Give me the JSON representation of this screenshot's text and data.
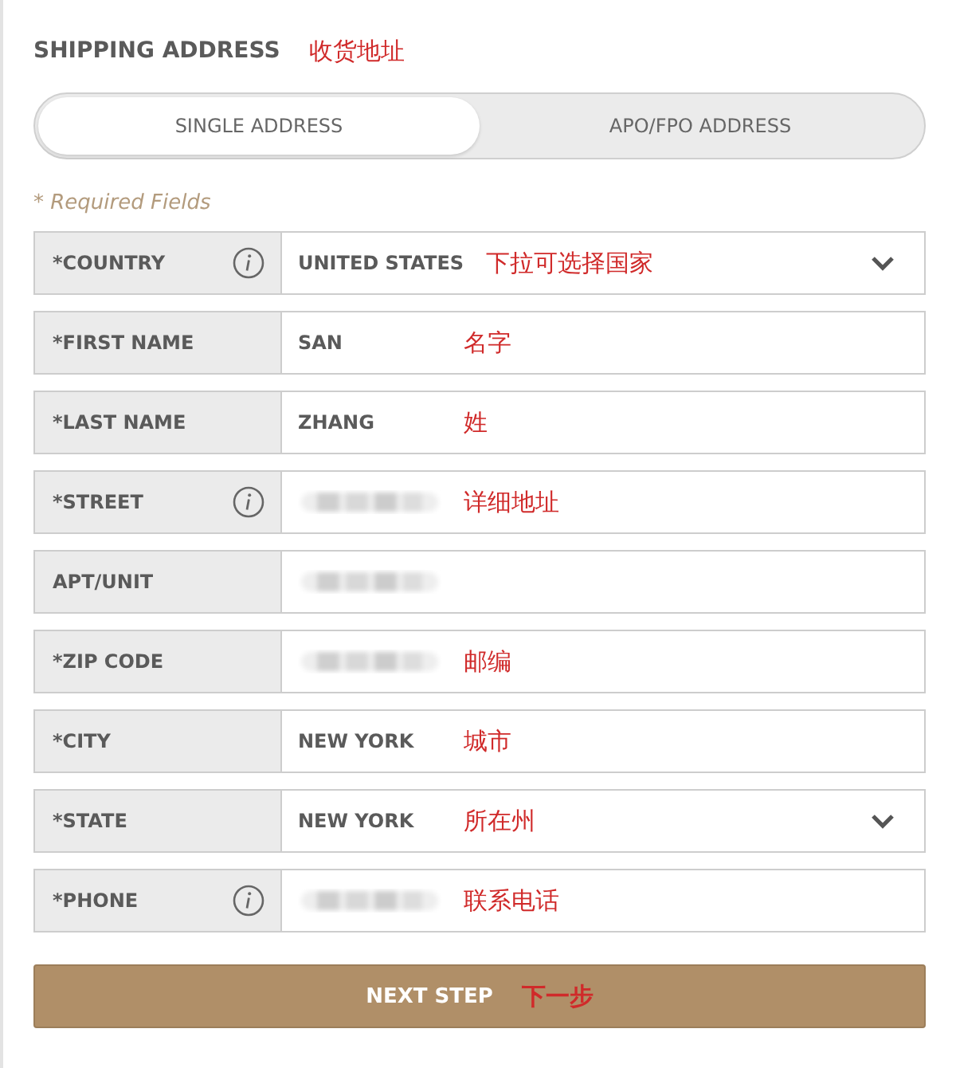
{
  "heading": {
    "title": "SHIPPING ADDRESS",
    "annotation": "收货地址"
  },
  "address_type_tabs": [
    {
      "label": "SINGLE ADDRESS",
      "selected": true
    },
    {
      "label": "APO/FPO ADDRESS",
      "selected": false
    }
  ],
  "required_note": "* Required Fields",
  "fields": [
    {
      "kind": "select",
      "label": "*COUNTRY",
      "info": true,
      "value": "UNITED STATES",
      "redacted": false,
      "annotation": "下拉可选择国家"
    },
    {
      "kind": "text",
      "label": "*FIRST NAME",
      "info": false,
      "value": "SAN",
      "redacted": false,
      "annotation": "名字"
    },
    {
      "kind": "text",
      "label": "*LAST NAME",
      "info": false,
      "value": "ZHANG",
      "redacted": false,
      "annotation": "姓"
    },
    {
      "kind": "text",
      "label": "*STREET",
      "info": true,
      "redacted": true,
      "annotation": "详细地址"
    },
    {
      "kind": "text",
      "label": "APT/UNIT",
      "info": false,
      "redacted": true
    },
    {
      "kind": "text",
      "label": "*ZIP CODE",
      "info": false,
      "redacted": true,
      "annotation": "邮编"
    },
    {
      "kind": "text",
      "label": "*CITY",
      "info": false,
      "value": "NEW YORK",
      "redacted": false,
      "annotation": "城市"
    },
    {
      "kind": "select",
      "label": "*STATE",
      "info": false,
      "value": "NEW YORK",
      "redacted": false,
      "annotation": "所在州"
    },
    {
      "kind": "text",
      "label": "*PHONE",
      "info": true,
      "redacted": true,
      "annotation": "联系电话"
    }
  ],
  "next_button": {
    "label": "NEXT STEP",
    "annotation": "下一步"
  }
}
